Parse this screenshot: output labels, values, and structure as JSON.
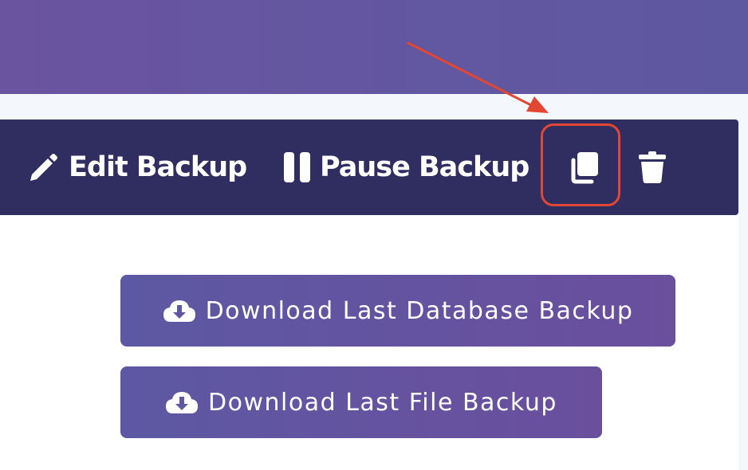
{
  "toolbar": {
    "edit_label": "Edit Backup",
    "pause_label": "Pause Backup",
    "icons": {
      "edit": "pencil-icon",
      "pause": "pause-icon",
      "copy": "copy-icon",
      "delete": "trash-icon"
    }
  },
  "downloads": {
    "database_label": "Download Last Database Backup",
    "file_label": "Download Last File Backup",
    "icon": "cloud-download-icon"
  },
  "colors": {
    "banner": "#6257a1",
    "toolbar_bg": "#302d60",
    "annotation": "#e24733",
    "button_gradient_start": "#5d58a3",
    "button_gradient_end": "#6a4f9d",
    "page_bg": "#f4f7fb"
  }
}
